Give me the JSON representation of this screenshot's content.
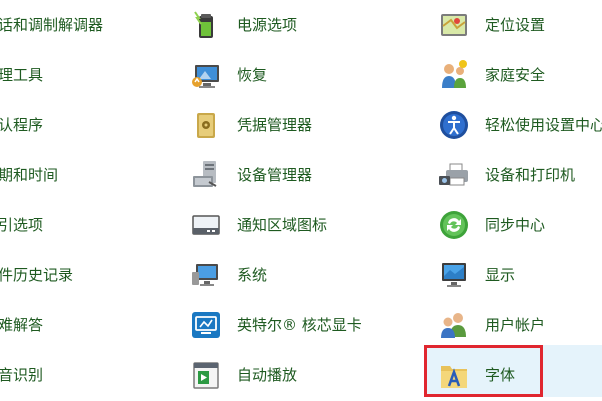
{
  "column1": [
    {
      "label": "话和调制解调器"
    },
    {
      "label": "理工具"
    },
    {
      "label": "认程序"
    },
    {
      "label": "期和时间"
    },
    {
      "label": "引选项"
    },
    {
      "label": "件历史记录"
    },
    {
      "label": "难解答"
    },
    {
      "label": "音识别"
    }
  ],
  "column2": [
    {
      "label": "电源选项",
      "icon": "battery-icon"
    },
    {
      "label": "恢复",
      "icon": "recovery-monitor-icon"
    },
    {
      "label": "凭据管理器",
      "icon": "credential-safe-icon"
    },
    {
      "label": "设备管理器",
      "icon": "device-manager-icon"
    },
    {
      "label": "通知区域图标",
      "icon": "notification-tray-icon"
    },
    {
      "label": "系统",
      "icon": "system-monitor-icon"
    },
    {
      "label": "英特尔® 核芯显卡",
      "icon": "intel-graphics-icon"
    },
    {
      "label": "自动播放",
      "icon": "autoplay-icon"
    }
  ],
  "column3": [
    {
      "label": "定位设置",
      "icon": "location-map-icon"
    },
    {
      "label": "家庭安全",
      "icon": "family-safety-icon"
    },
    {
      "label": "轻松使用设置中心",
      "icon": "ease-of-access-icon"
    },
    {
      "label": "设备和打印机",
      "icon": "printer-camera-icon"
    },
    {
      "label": "同步中心",
      "icon": "sync-center-icon"
    },
    {
      "label": "显示",
      "icon": "display-monitor-icon"
    },
    {
      "label": "用户帐户",
      "icon": "user-accounts-icon"
    },
    {
      "label": "字体",
      "icon": "fonts-folder-icon"
    }
  ],
  "colors": {
    "link_text": "#1e5a20",
    "highlight_border": "#e0262f",
    "hover_bg": "#e5f3fb"
  }
}
